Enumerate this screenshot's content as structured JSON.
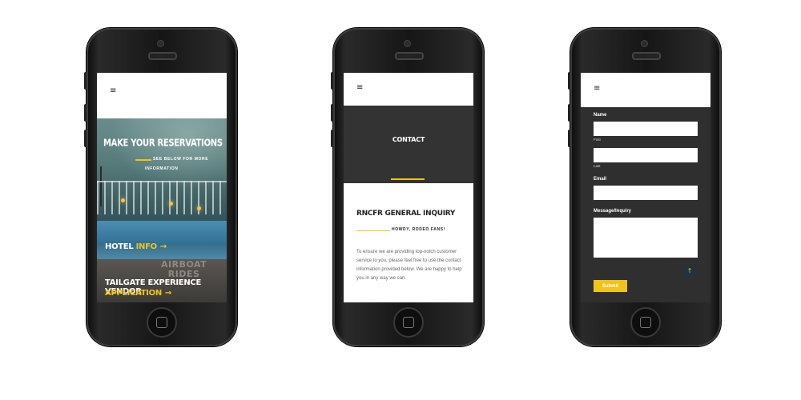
{
  "phone1": {
    "menu_icon": "hamburger-icon",
    "menu_glyph": "≡",
    "hero_title": "MAKE YOUR RESERVATIONS",
    "hero_sub_line1": "SEE BELOW FOR MORE",
    "hero_sub_line2": "INFORMATION",
    "hotel_prefix": "HOTEL ",
    "hotel_accent": "INFO",
    "arrow_glyph": "→",
    "airboat_line1": "AIRBOAT",
    "airboat_line2": "RIDES",
    "tailgate_title": "TAILGATE EXPERIENCE VENDOR",
    "application_label": "APPLICATION"
  },
  "phone2": {
    "menu_glyph": "≡",
    "banner_title": "CONTACT",
    "section_title": "RNCFR GENERAL INQUIRY",
    "tagline": "HOWDY, RODEO FANS!",
    "paragraph": "To ensure we are providing top-notch customer service to you, please feel free to use the contact information provided below. We are happy to help you in any way we can."
  },
  "phone3": {
    "menu_glyph": "≡",
    "name_label": "Name",
    "first_label": "First",
    "last_label": "Last",
    "email_label": "Email",
    "message_label": "Message/Inquiry",
    "first_value": "",
    "last_value": "",
    "email_value": "",
    "message_value": "",
    "submit_label": "Submit",
    "scroll_top_glyph": "↑"
  },
  "colors": {
    "accent": "#f0c419",
    "dark_band": "#333333",
    "form_bg": "#2f2f2f",
    "scroll_btn": "#1f3342"
  }
}
